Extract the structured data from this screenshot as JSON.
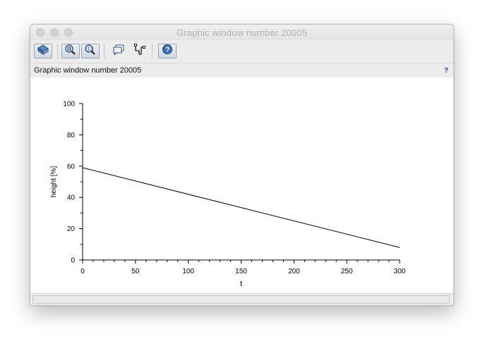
{
  "window": {
    "title": "Graphic window number 20005",
    "subtitle": "Graphic window number 20005",
    "help_mark": "?"
  },
  "toolbar": {
    "buttons": [
      {
        "icon": "rotate-icon",
        "label": ""
      },
      {
        "icon": "zoom-icon",
        "label": ""
      },
      {
        "icon": "zoom-reset-icon",
        "label": ""
      },
      {
        "icon": "datatip-icon",
        "label": ""
      },
      {
        "icon": "datatip-manager-icon",
        "label": ""
      },
      {
        "icon": "help-icon",
        "label": ""
      }
    ]
  },
  "chart_data": {
    "type": "line",
    "title": "",
    "xlabel": "t",
    "ylabel": "height [%]",
    "xlim": [
      0,
      300
    ],
    "ylim": [
      0,
      100
    ],
    "xticks": [
      0,
      50,
      100,
      150,
      200,
      250,
      300
    ],
    "yticks": [
      0,
      20,
      40,
      60,
      80,
      100
    ],
    "grid": false,
    "series": [
      {
        "x": [
          0,
          300
        ],
        "y": [
          59,
          8
        ]
      }
    ]
  },
  "status": {
    "text": ""
  }
}
